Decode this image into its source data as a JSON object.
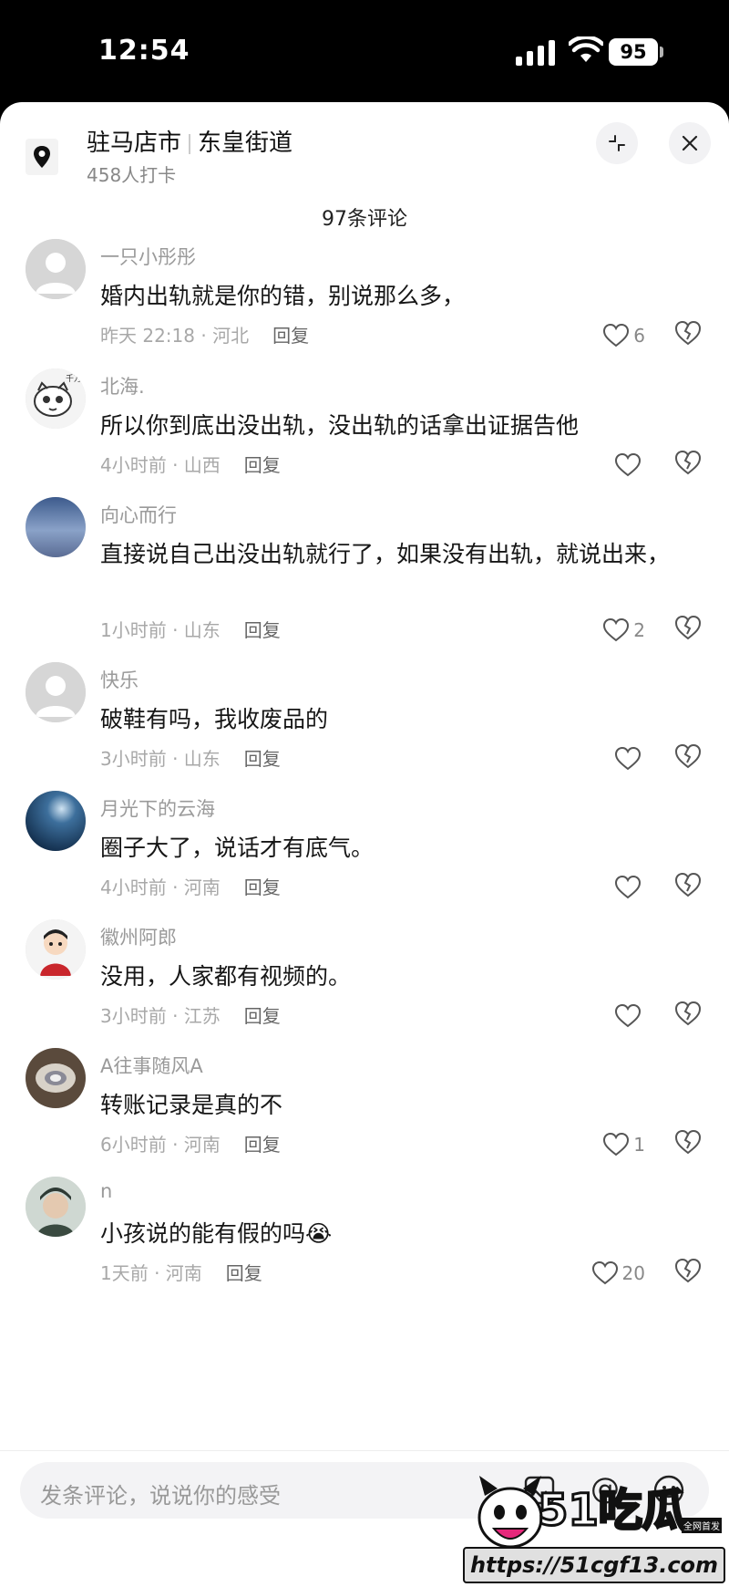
{
  "status_bar": {
    "time": "12:54",
    "battery": "95"
  },
  "location": {
    "city": "驻马店市",
    "street": "东皇街道",
    "checkins": "458人打卡"
  },
  "comment_count": "97条评论",
  "reply_label": "回复",
  "comments": [
    {
      "user": "一只小彤彤",
      "text": "婚内出轨就是你的错，别说那么多，",
      "meta": "昨天 22:18 · 河北",
      "likes": "6"
    },
    {
      "user": "北海.",
      "text": "所以你到底出没出轨，没出轨的话拿出证据告他",
      "meta": "4小时前 · 山西",
      "likes": ""
    },
    {
      "user": "向心而行",
      "text": "直接说自己出没出轨就行了，如果没有出轨，就说出来，",
      "meta": "1小时前 · 山东",
      "likes": "2"
    },
    {
      "user": "快乐",
      "text": "破鞋有吗，我收废品的",
      "meta": "3小时前 · 山东",
      "likes": ""
    },
    {
      "user": "月光下的云海",
      "text": "圈子大了，说话才有底气。",
      "meta": "4小时前 · 河南",
      "likes": ""
    },
    {
      "user": "徽州阿郎",
      "text": "没用，人家都有视频的。",
      "meta": "3小时前 · 江苏",
      "likes": ""
    },
    {
      "user": "A往事随风A",
      "text": "转账记录是真的不",
      "meta": "6小时前 · 河南",
      "likes": "1"
    },
    {
      "user": "n",
      "text": "小孩说的能有假的吗😭",
      "meta": "1天前 · 河南",
      "likes": "20"
    }
  ],
  "input": {
    "placeholder": "发条评论，说说你的感受"
  },
  "watermark": {
    "logo_a": "51",
    "logo_b": "吃瓜",
    "tag": "全网首发",
    "url": "https://51cgf13.com"
  },
  "icons": [
    "location-pin-icon",
    "shrink-icon",
    "close-icon",
    "heart-icon",
    "broken-heart-icon",
    "image-icon",
    "at-icon",
    "emoji-icon"
  ]
}
